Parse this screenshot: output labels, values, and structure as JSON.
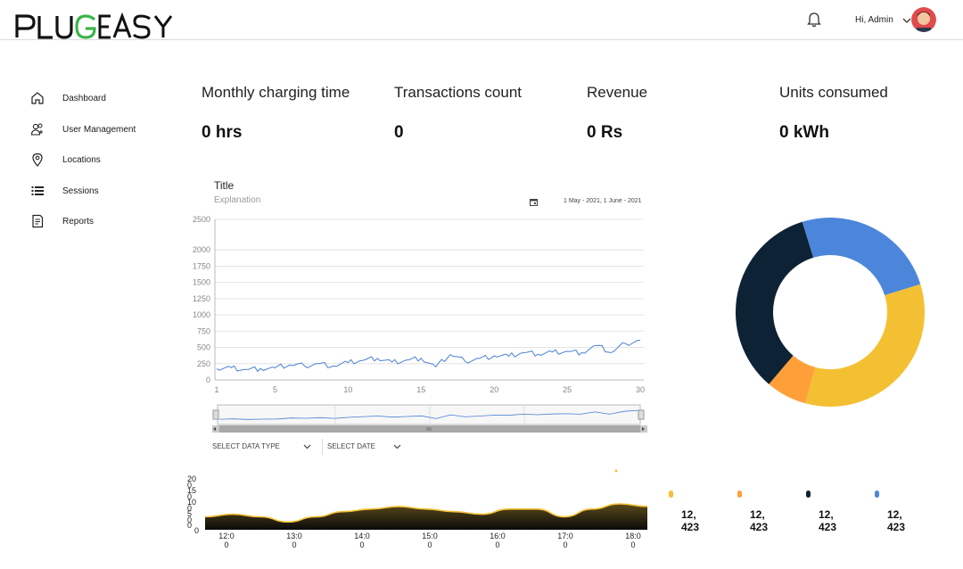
{
  "header": {
    "logo_text": "PLUGEASY",
    "greeting": "Hi, Admin",
    "brand_green": "#3bb54a"
  },
  "sidebar": {
    "items": [
      {
        "label": "Dashboard",
        "icon": "home-icon"
      },
      {
        "label": "User Management",
        "icon": "users-icon"
      },
      {
        "label": "Locations",
        "icon": "location-pin-icon"
      },
      {
        "label": "Sessions",
        "icon": "list-icon"
      },
      {
        "label": "Reports",
        "icon": "report-icon"
      }
    ]
  },
  "kpis": [
    {
      "label": "Monthly charging time",
      "value": "0 hrs"
    },
    {
      "label": "Transactions count",
      "value": "0"
    },
    {
      "label": "Revenue",
      "value": "0 Rs"
    },
    {
      "label": "Units consumed",
      "value": "0 kWh"
    }
  ],
  "line_chart": {
    "title": "Title",
    "subtitle": "Explanation",
    "date_range": "1 May - 2021, 1 June - 2021",
    "line_color": "#4a7fd4"
  },
  "filters": {
    "data_type_label": "SELECT DATA TYPE",
    "date_label": "SELECT DATE"
  },
  "legend": [
    {
      "color": "#f4c033",
      "value": "12,\n423"
    },
    {
      "color": "#ff9f3a",
      "value": "12,\n423"
    },
    {
      "color": "#0e2235",
      "value": "12,\n423"
    },
    {
      "color": "#4c86db",
      "value": "12,\n423"
    }
  ],
  "chart_data": [
    {
      "type": "line",
      "title": "Title",
      "x": [
        1,
        2,
        3,
        4,
        5,
        6,
        7,
        8,
        9,
        10,
        11,
        12,
        13,
        14,
        15,
        16,
        17,
        18,
        19,
        20,
        21,
        22,
        23,
        24,
        25,
        26,
        27,
        28,
        29,
        30
      ],
      "series": [
        {
          "values": [
            170,
            190,
            160,
            175,
            185,
            230,
            220,
            250,
            215,
            265,
            300,
            330,
            275,
            305,
            335,
            200,
            390,
            290,
            330,
            370,
            365,
            420,
            395,
            430,
            440,
            420,
            530,
            420,
            560,
            610
          ]
        }
      ],
      "x_ticks": [
        "1",
        "5",
        "10",
        "15",
        "20",
        "25",
        "30"
      ],
      "y_ticks": [
        "0",
        "250",
        "500",
        "750",
        "1000",
        "1250",
        "1500",
        "1750",
        "2000",
        "2500"
      ],
      "ylim": [
        0,
        2500
      ],
      "grid": true
    },
    {
      "type": "pie",
      "slices": [
        {
          "value": 25,
          "color": "#4c86db"
        },
        {
          "value": 34,
          "color": "#f4c033"
        },
        {
          "value": 7,
          "color": "#ff9f3a"
        },
        {
          "value": 34,
          "color": "#0e2235"
        }
      ]
    },
    {
      "type": "area",
      "x_ticks": [
        "12:0\n0",
        "13:0\n0",
        "14:0\n0",
        "15:0\n0",
        "16:0\n0",
        "17:0\n0",
        "18:0\n0"
      ],
      "y_ticks": [
        "20",
        "15",
        "10",
        "5",
        "0"
      ],
      "y_ticks_stub": [
        "0",
        "0",
        "0",
        "0"
      ],
      "values": [
        5,
        6,
        5,
        3,
        5,
        7,
        8,
        9,
        8,
        7,
        6,
        8,
        8,
        5,
        8,
        10,
        9
      ],
      "ylim": [
        0,
        20
      ],
      "line_color": "#f4c033"
    }
  ]
}
